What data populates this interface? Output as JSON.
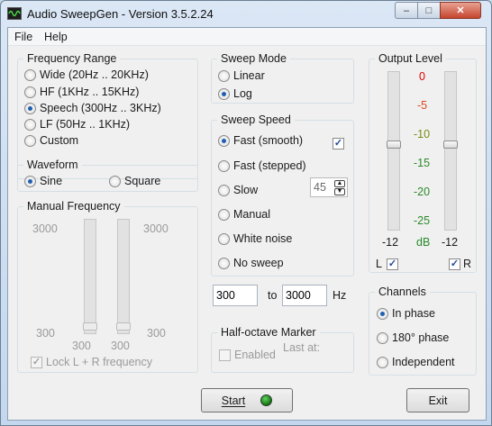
{
  "window": {
    "title": "Audio SweepGen - Version 3.5.2.24",
    "min_glyph": "–",
    "max_glyph": "□",
    "close_glyph": "✕"
  },
  "menu": {
    "file": "File",
    "help": "Help"
  },
  "frequency_range": {
    "title": "Frequency Range",
    "options": [
      {
        "label": "Wide  (20Hz .. 20KHz)",
        "selected": false
      },
      {
        "label": "HF  (1KHz .. 15KHz)",
        "selected": false
      },
      {
        "label": "Speech  (300Hz .. 3KHz)",
        "selected": true
      },
      {
        "label": "LF  (50Hz .. 1KHz)",
        "selected": false
      },
      {
        "label": "Custom",
        "selected": false
      }
    ]
  },
  "waveform": {
    "title": "Waveform",
    "sine": "Sine",
    "square": "Square",
    "selected": "Sine"
  },
  "manual_frequency": {
    "title": "Manual Frequency",
    "left_top": "3000",
    "left_bottom": "300",
    "right_top": "3000",
    "right_bottom": "300",
    "slider_left_value": "300",
    "slider_right_value": "300",
    "lock_label": "Lock L + R frequency",
    "lock_checked": true,
    "enabled": false
  },
  "sweep_mode": {
    "title": "Sweep Mode",
    "linear": "Linear",
    "log": "Log",
    "selected": "Log"
  },
  "sweep_speed": {
    "title": "Sweep Speed",
    "options": [
      {
        "label": "Fast (smooth)",
        "selected": true
      },
      {
        "label": "Fast (stepped)",
        "selected": false
      },
      {
        "label": "Slow",
        "selected": false
      },
      {
        "label": "Manual",
        "selected": false
      },
      {
        "label": "White noise",
        "selected": false
      },
      {
        "label": "No sweep",
        "selected": false
      }
    ],
    "fast_check": true,
    "slow_value": "45"
  },
  "range": {
    "from": "300",
    "to_label": "to",
    "to": "3000",
    "unit": "Hz"
  },
  "half_octave": {
    "title": "Half-octave Marker",
    "enabled_label": "Enabled",
    "last_at": "Last at:"
  },
  "output_level": {
    "title": "Output Level",
    "scale": [
      "0",
      "-5",
      "-10",
      "-15",
      "-20",
      "-25"
    ],
    "scale_colors": [
      "#e00000",
      "#d84a1a",
      "#7a8a12",
      "#2a8a2a",
      "#2a8a2a",
      "#2a8a2a"
    ],
    "left_value": "-12",
    "unit": "dB",
    "right_value": "-12",
    "l_label": "L",
    "r_label": "R",
    "l_checked": true,
    "r_checked": true
  },
  "channels": {
    "title": "Channels",
    "options": [
      {
        "label": "In phase",
        "selected": true
      },
      {
        "label": "180° phase",
        "selected": false
      },
      {
        "label": "Independent",
        "selected": false
      }
    ]
  },
  "buttons": {
    "start": "Start",
    "exit": "Exit",
    "start_led_color": "#1a8a1a"
  }
}
